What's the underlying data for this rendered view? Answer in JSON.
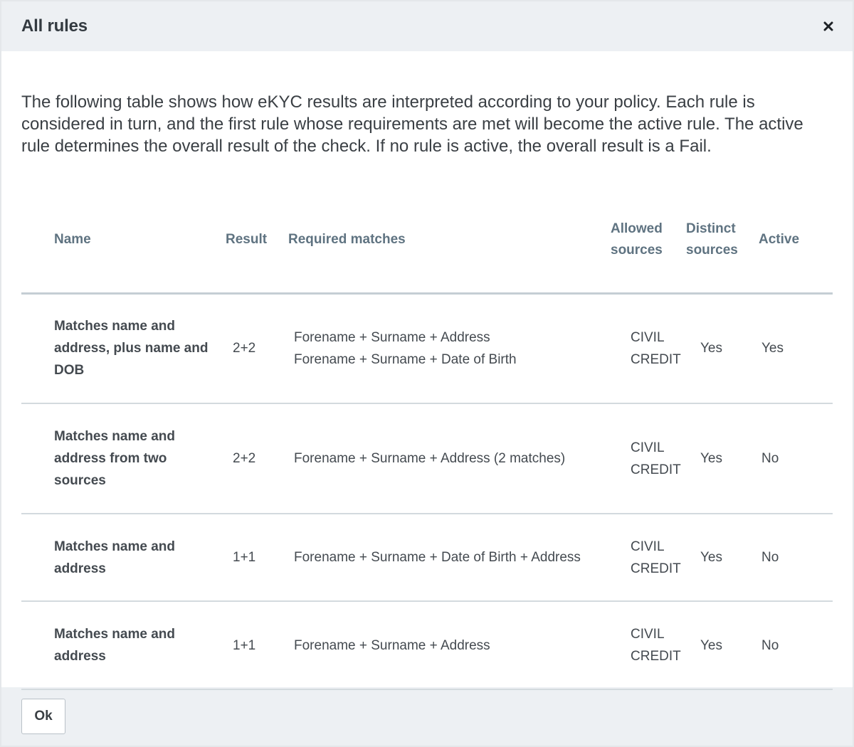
{
  "dialog": {
    "title": "All rules",
    "intro": "The following table shows how eKYC results are interpreted according to your policy. Each rule is considered in turn, and the first rule whose requirements are met will become the active rule. The active rule determines the overall result of the check. If no rule is active, the overall result is a Fail.",
    "ok_label": "Ok"
  },
  "table": {
    "headers": {
      "name": "Name",
      "result": "Result",
      "required": "Required matches",
      "allowed_1": "Allowed",
      "allowed_2": "sources",
      "distinct_1": "Distinct",
      "distinct_2": "sources",
      "active": "Active"
    },
    "rows": [
      {
        "name": "Matches name and address, plus name and DOB",
        "result": "2+2",
        "required": [
          "Forename + Surname + Address",
          "Forename + Surname + Date of Birth"
        ],
        "sources": [
          "CIVIL",
          "CREDIT"
        ],
        "distinct": "Yes",
        "active": "Yes"
      },
      {
        "name": "Matches name and address from two sources",
        "result": "2+2",
        "required": [
          "Forename + Surname + Address (2 matches)"
        ],
        "sources": [
          "CIVIL",
          "CREDIT"
        ],
        "distinct": "Yes",
        "active": "No"
      },
      {
        "name": "Matches name and address",
        "result": "1+1",
        "required": [
          "Forename + Surname + Date of Birth + Address"
        ],
        "sources": [
          "CIVIL",
          "CREDIT"
        ],
        "distinct": "Yes",
        "active": "No"
      },
      {
        "name": "Matches name and address",
        "result": "1+1",
        "required": [
          "Forename + Surname + Address"
        ],
        "sources": [
          "CIVIL",
          "CREDIT"
        ],
        "distinct": "Yes",
        "active": "No"
      }
    ]
  },
  "icons": {
    "close": "close-icon"
  }
}
